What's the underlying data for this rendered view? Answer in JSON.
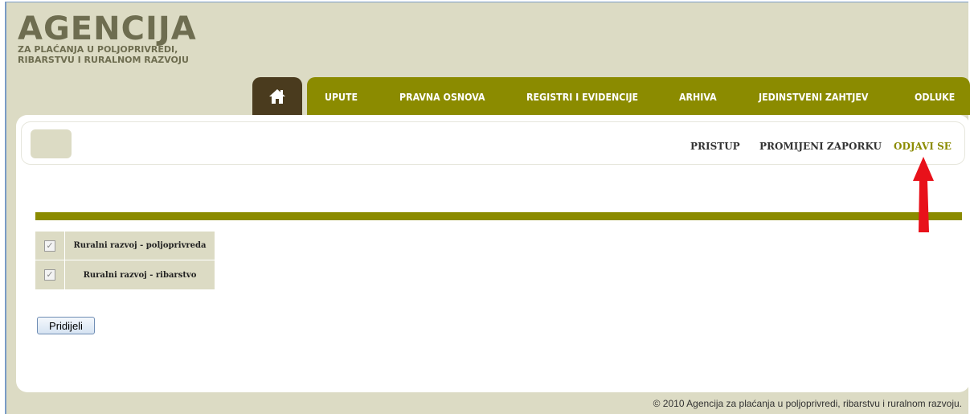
{
  "logo": {
    "title": "AGENCIJA",
    "subtitle_line1": "ZA PLAĆANJA U POLJOPRIVREDI,",
    "subtitle_line2": "RIBARSTVU I RURALNOM RAZVOJU"
  },
  "nav": {
    "home_icon": "home-icon",
    "items": [
      {
        "label": "UPUTE"
      },
      {
        "label": "PRAVNA OSNOVA"
      },
      {
        "label": "REGISTRI I EVIDENCIJE"
      },
      {
        "label": "ARHIVA"
      },
      {
        "label": "JEDINSTVENI ZAHTJEV"
      },
      {
        "label": "ODLUKE"
      }
    ]
  },
  "userbar": {
    "pristup": "PRISTUP",
    "promijeni": "PROMIJENI ZAPORKU",
    "odjavi": "ODJAVI SE"
  },
  "options": [
    {
      "label": "Ruralni razvoj - poljoprivreda",
      "checked": true
    },
    {
      "label": "Ruralni razvoj - ribarstvo",
      "checked": true
    }
  ],
  "form": {
    "submit_label": "Pridijeli"
  },
  "footer": {
    "copyright": "© 2010 Agencija za plaćanja u poljoprivredi, ribarstvu i ruralnom razvoju."
  },
  "colors": {
    "olive": "#8b8b00",
    "beige": "#dcdbc4",
    "home_tab": "#4a3b1e",
    "arrow": "#e8111a"
  }
}
